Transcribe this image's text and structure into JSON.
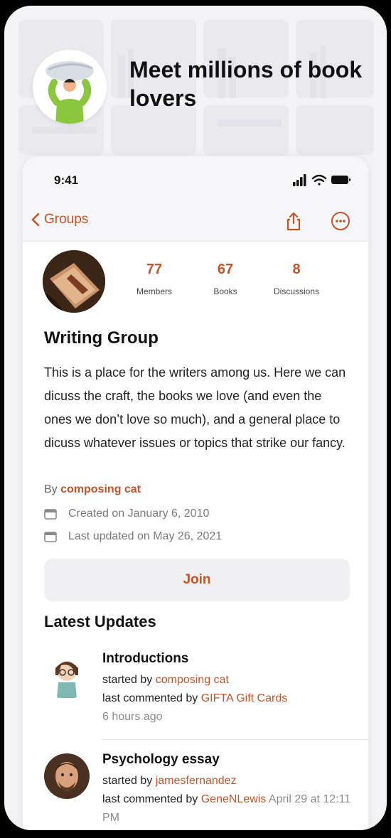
{
  "promo": {
    "headline": "Meet millions of book lovers"
  },
  "status_bar": {
    "time": "9:41"
  },
  "nav": {
    "back_label": "Groups",
    "share_icon": "share-icon",
    "more_icon": "more-icon"
  },
  "group": {
    "stats": [
      {
        "value": "77",
        "label": "Members"
      },
      {
        "value": "67",
        "label": "Books"
      },
      {
        "value": "8",
        "label": "Discussions"
      }
    ],
    "title": "Writing Group",
    "description": "This is a place for the writers among us. Here we can dicuss the craft, the books we love (and even the ones we don’t love so much), and a general place to dicuss whatever issues or topics that strike our fancy.",
    "by_prefix": "By",
    "author": "composing cat",
    "created": "Created on January 6, 2010",
    "updated": "Last updated on May 26, 2021",
    "join_label": "Join"
  },
  "latest_updates": {
    "title": "Latest Updates",
    "items": [
      {
        "topic": "Introductions",
        "started_prefix": "started by",
        "started_by": "composing cat",
        "commented_prefix": "last commented by",
        "commented_by": "GIFTA Gift Cards",
        "time": "6 hours ago"
      },
      {
        "topic": "Psychology essay",
        "started_prefix": "started by",
        "started_by": "jamesfernandez",
        "commented_prefix": "last commented by",
        "commented_by": "GeneNLewis",
        "time": "April 29 at 12:11 PM"
      }
    ]
  },
  "colors": {
    "accent": "#c2542a",
    "background": "#f3f3f6"
  }
}
